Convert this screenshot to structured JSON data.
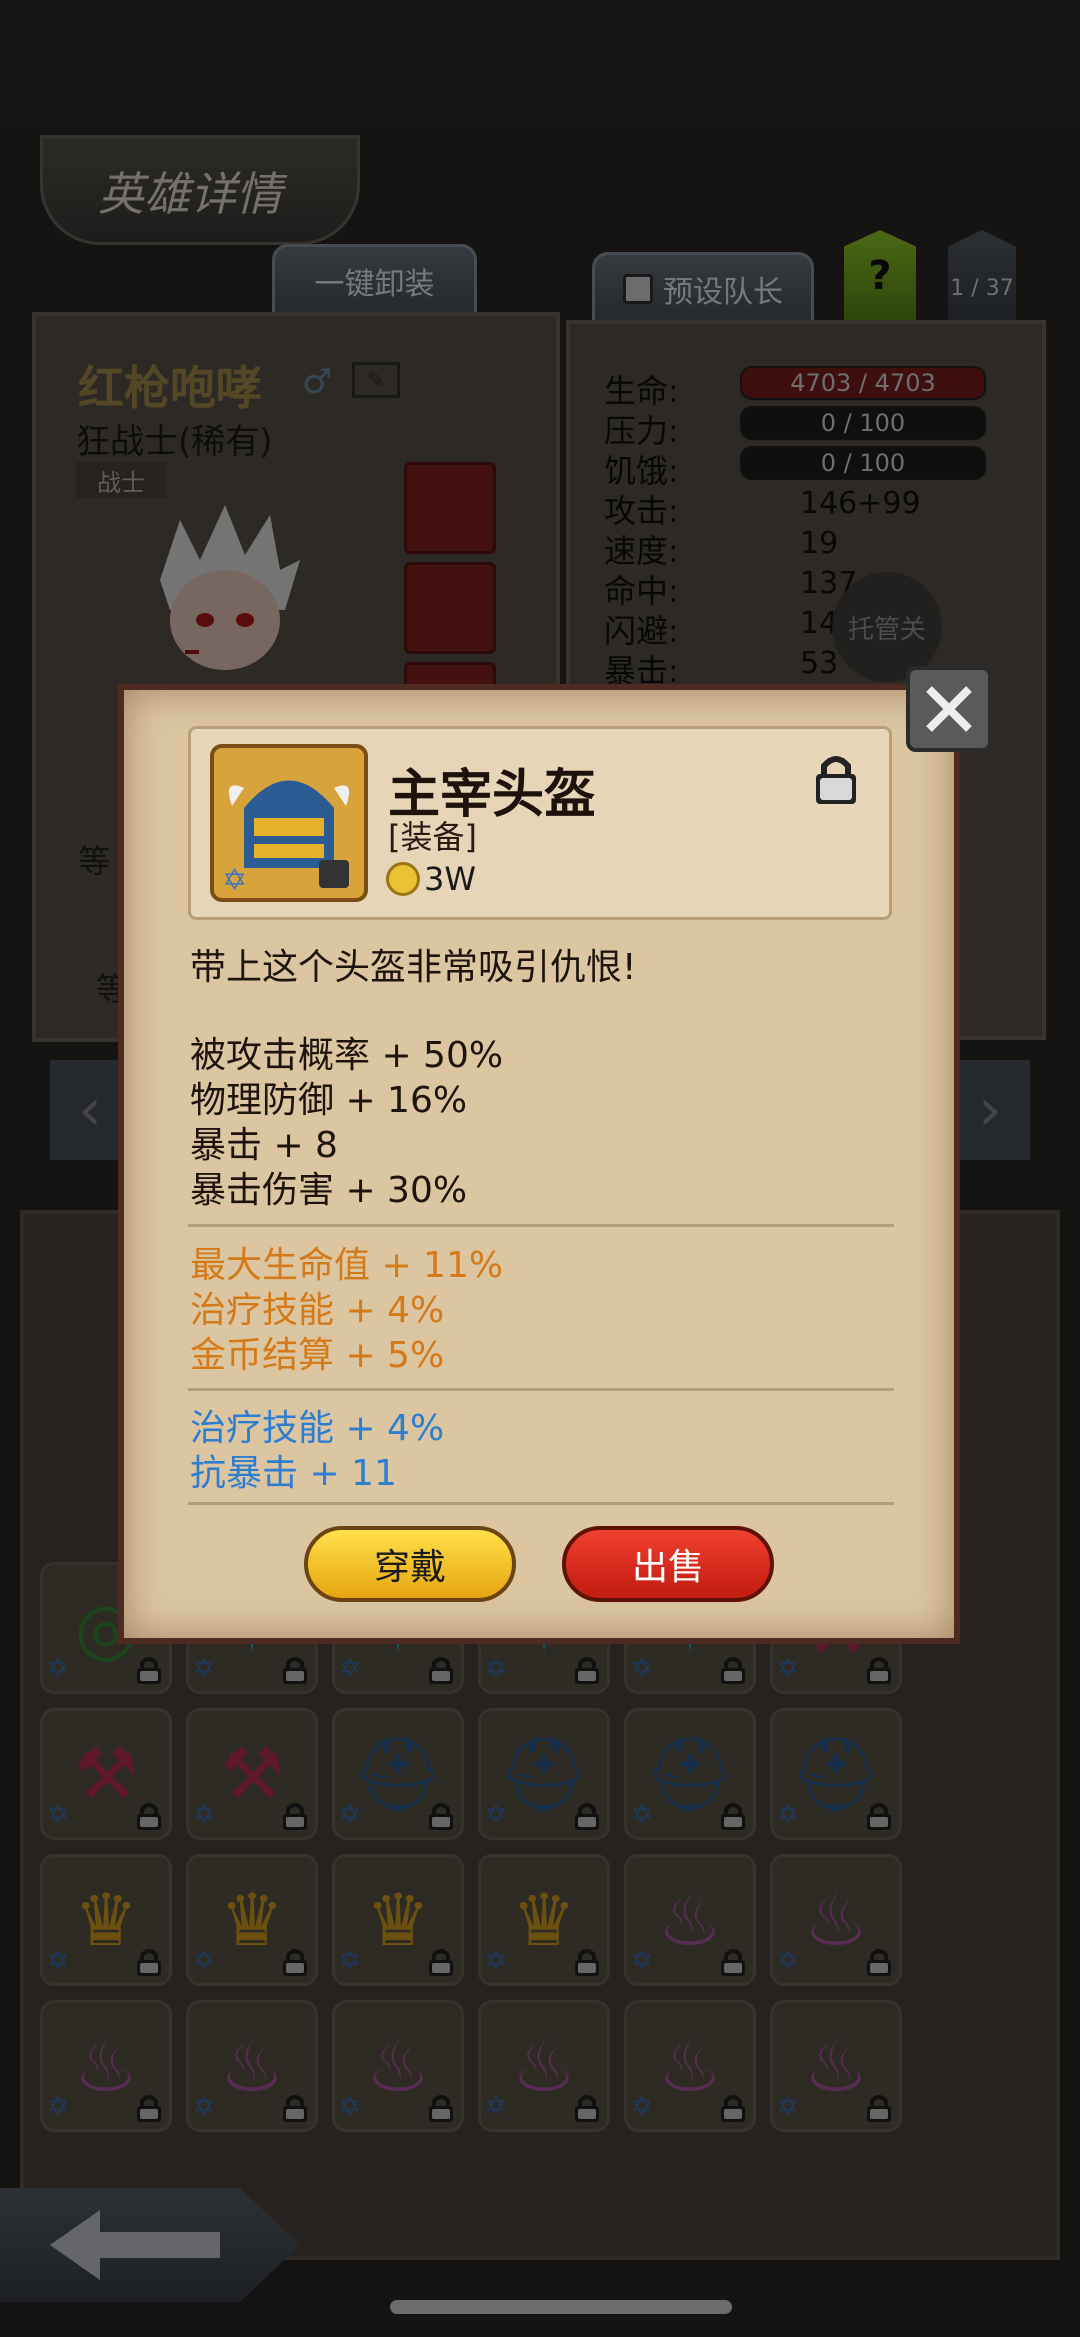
{
  "header": {
    "title": "英雄详情",
    "unequip_all": "一键卸装",
    "preset_leader": "预设队长",
    "help": "?",
    "page": "1 / 37"
  },
  "hero": {
    "name": "红枪咆哮",
    "class": "狂战士(稀有)",
    "tag": "战士",
    "side_label_1": "等",
    "side_label_2": "等"
  },
  "stats": {
    "hp_label": "生命:",
    "hp_value": "4703 / 4703",
    "stress_label": "压力:",
    "stress_value": "0 / 100",
    "hunger_label": "饥饿:",
    "hunger_value": "0 / 100",
    "atk_label": "攻击:",
    "atk_value": "146+99",
    "spd_label": "速度:",
    "spd_value": "19",
    "hit_label": "命中:",
    "hit_value": "137",
    "dodge_label": "闪避:",
    "dodge_value": "14",
    "crit_label": "暴击:",
    "crit_value": "53",
    "auto_label": "托管关"
  },
  "dialog": {
    "item_name": "主宰头盔",
    "item_type": "[装备]",
    "price": "3W",
    "description": "带上这个头盔非常吸引仇恨!",
    "base_stats": [
      "被攻击概率 + 50%",
      "物理防御 + 16%",
      "暴击 + 8",
      "暴击伤害 + 30%"
    ],
    "orange_stats": [
      "最大生命值 + 11%",
      "治疗技能 + 4%",
      "金币结算 + 5%"
    ],
    "blue_stats": [
      "治疗技能 + 4%",
      "抗暴击 + 11"
    ],
    "wear_button": "穿戴",
    "sell_button": "出售"
  },
  "colors": {
    "orange_stat": "#d47a18",
    "blue_stat": "#2e7ed0",
    "wear_button": "#f5c21f",
    "sell_button": "#e02a1c",
    "dialog_bg": "#dcc6a2"
  },
  "bag": {
    "rows": [
      [
        "ring-icon",
        "spiked-armor-icon",
        "spiked-armor-icon",
        "spiked-armor-icon",
        "spiked-armor-icon",
        "axe-icon"
      ],
      [
        "axe-icon",
        "axe-icon",
        "helmet-icon",
        "helmet-icon",
        "helmet-icon",
        "helmet-icon"
      ],
      [
        "crown-ring-icon",
        "crown-ring-icon",
        "crown-ring-icon",
        "crown-ring-icon",
        "pouch-icon",
        "pouch-icon"
      ],
      [
        "pouch-icon",
        "pouch-icon",
        "pouch-icon",
        "pouch-icon",
        "pouch-icon",
        "pouch-icon"
      ]
    ]
  }
}
